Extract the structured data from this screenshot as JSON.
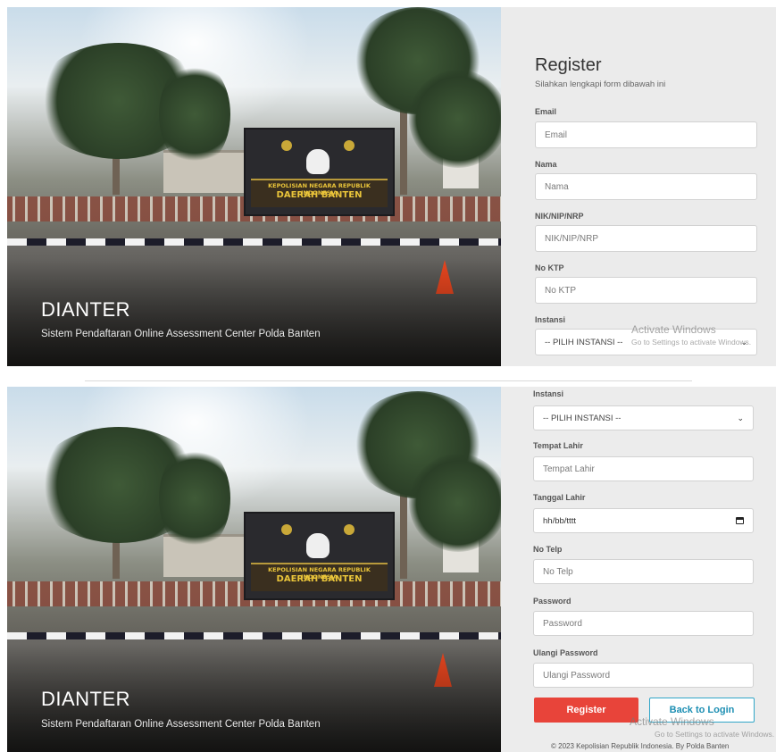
{
  "hero": {
    "title": "DIANTER",
    "subtitle": "Sistem Pendaftaran Online Assessment Center Polda Banten",
    "sign_line1": "KEPOLISIAN NEGARA REPUBLIK INDONESIA",
    "sign_line2": "DAERAH BANTEN"
  },
  "form": {
    "title": "Register",
    "subtitle": "Silahkan lengkapi form dibawah ini",
    "email": {
      "label": "Email",
      "placeholder": "Email"
    },
    "nama": {
      "label": "Nama",
      "placeholder": "Nama"
    },
    "nik": {
      "label": "NIK/NIP/NRP",
      "placeholder": "NIK/NIP/NRP"
    },
    "ktp": {
      "label": "No KTP",
      "placeholder": "No KTP"
    },
    "instansi": {
      "label": "Instansi",
      "selected": "-- PILIH INSTANSI --"
    },
    "tempat_lahir": {
      "label": "Tempat Lahir",
      "placeholder": "Tempat Lahir"
    },
    "tanggal_lahir": {
      "label": "Tanggal Lahir",
      "placeholder": "hh/bb/tttt"
    },
    "telp": {
      "label": "No Telp",
      "placeholder": "No Telp"
    },
    "password": {
      "label": "Password",
      "placeholder": "Password"
    },
    "ulangi_password": {
      "label": "Ulangi Password",
      "placeholder": "Ulangi Password"
    },
    "register_button": "Register",
    "back_button": "Back to Login",
    "footer": "© 2023 Kepolisian Republik Indonesia. By Polda Banten"
  },
  "watermark": {
    "line1": "Activate Windows",
    "line2": "Go to Settings to activate Windows."
  },
  "colors": {
    "accent_red": "#e8443a",
    "accent_blue": "#31a6c8",
    "form_bg": "#ebebeb"
  }
}
